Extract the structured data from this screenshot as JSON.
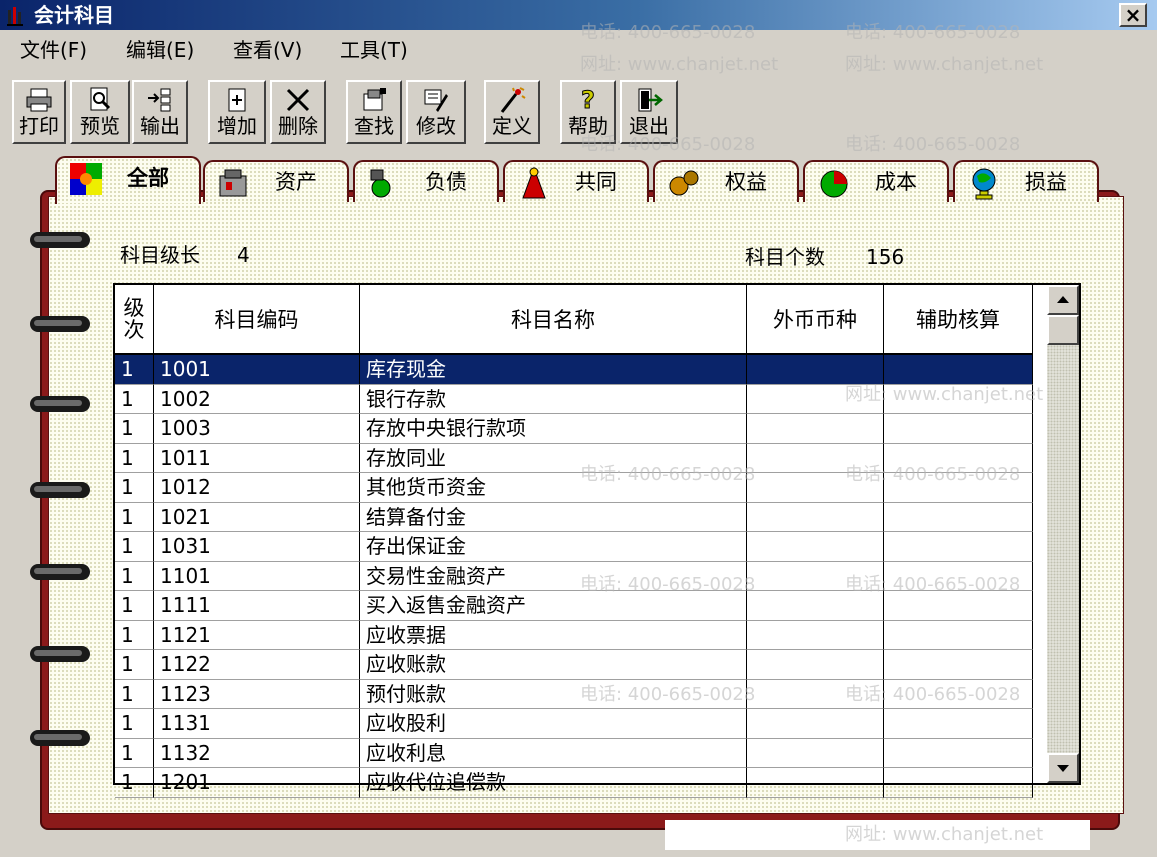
{
  "window": {
    "title": "会计科目",
    "close_label": "×"
  },
  "menu": [
    "文件(F)",
    "编辑(E)",
    "查看(V)",
    "工具(T)"
  ],
  "toolbar": [
    {
      "label": "打印",
      "icon": "printer-icon"
    },
    {
      "label": "预览",
      "icon": "preview-icon"
    },
    {
      "label": "输出",
      "icon": "export-icon"
    },
    {
      "label": "增加",
      "icon": "add-icon"
    },
    {
      "label": "删除",
      "icon": "delete-icon"
    },
    {
      "label": "查找",
      "icon": "find-icon"
    },
    {
      "label": "修改",
      "icon": "edit-icon"
    },
    {
      "label": "定义",
      "icon": "define-icon"
    },
    {
      "label": "帮助",
      "icon": "help-icon"
    },
    {
      "label": "退出",
      "icon": "exit-icon"
    }
  ],
  "tabs": [
    {
      "label": "全部",
      "active": true,
      "icon": "all-icon"
    },
    {
      "label": "资产",
      "active": false,
      "icon": "asset-icon"
    },
    {
      "label": "负债",
      "active": false,
      "icon": "liability-icon"
    },
    {
      "label": "共同",
      "active": false,
      "icon": "common-icon"
    },
    {
      "label": "权益",
      "active": false,
      "icon": "equity-icon"
    },
    {
      "label": "成本",
      "active": false,
      "icon": "cost-icon"
    },
    {
      "label": "损益",
      "active": false,
      "icon": "profit-loss-icon"
    }
  ],
  "info": {
    "level_label": "科目级长",
    "level_value": "4",
    "count_label": "科目个数",
    "count_value": "156"
  },
  "table": {
    "columns": [
      "级次",
      "科目编码",
      "科目名称",
      "外币币种",
      "辅助核算"
    ],
    "rows": [
      {
        "level": "1",
        "code": "1001",
        "name": "库存现金",
        "currency": "",
        "aux": "",
        "selected": true
      },
      {
        "level": "1",
        "code": "1002",
        "name": "银行存款",
        "currency": "",
        "aux": ""
      },
      {
        "level": "1",
        "code": "1003",
        "name": "存放中央银行款项",
        "currency": "",
        "aux": ""
      },
      {
        "level": "1",
        "code": "1011",
        "name": "存放同业",
        "currency": "",
        "aux": ""
      },
      {
        "level": "1",
        "code": "1012",
        "name": "其他货币资金",
        "currency": "",
        "aux": ""
      },
      {
        "level": "1",
        "code": "1021",
        "name": "结算备付金",
        "currency": "",
        "aux": ""
      },
      {
        "level": "1",
        "code": "1031",
        "name": "存出保证金",
        "currency": "",
        "aux": ""
      },
      {
        "level": "1",
        "code": "1101",
        "name": "交易性金融资产",
        "currency": "",
        "aux": ""
      },
      {
        "level": "1",
        "code": "1111",
        "name": "买入返售金融资产",
        "currency": "",
        "aux": ""
      },
      {
        "level": "1",
        "code": "1121",
        "name": "应收票据",
        "currency": "",
        "aux": ""
      },
      {
        "level": "1",
        "code": "1122",
        "name": "应收账款",
        "currency": "",
        "aux": ""
      },
      {
        "level": "1",
        "code": "1123",
        "name": "预付账款",
        "currency": "",
        "aux": ""
      },
      {
        "level": "1",
        "code": "1131",
        "name": "应收股利",
        "currency": "",
        "aux": ""
      },
      {
        "level": "1",
        "code": "1132",
        "name": "应收利息",
        "currency": "",
        "aux": ""
      },
      {
        "level": "1",
        "code": "1201",
        "name": "应收代位追偿款",
        "currency": "",
        "aux": ""
      }
    ]
  },
  "watermark": {
    "phone": "电话: 400-665-0028",
    "site": "网址: www.chanjet.net"
  },
  "colors": {
    "selection": "#0a246a",
    "cover": "#8b1a1a",
    "page": "#fdfdf0"
  }
}
